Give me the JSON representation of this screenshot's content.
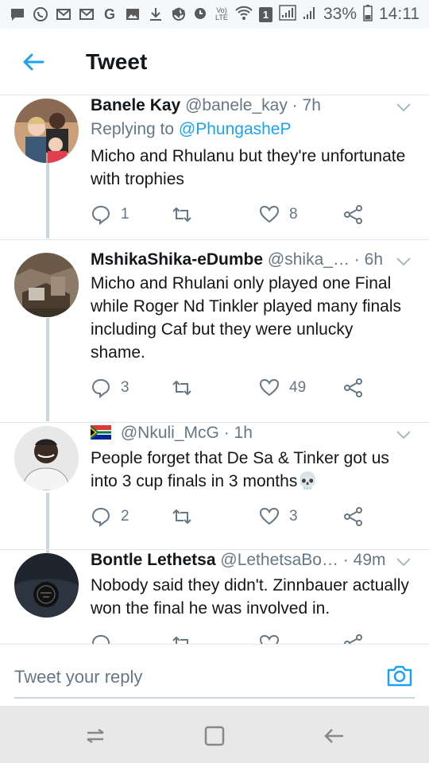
{
  "status_bar": {
    "left_icons": [
      "message-icon",
      "whatsapp-icon",
      "gmail-icon",
      "gmail-icon",
      "google-icon",
      "gallery-icon",
      "download-icon",
      "sync-icon"
    ],
    "right_icons": [
      "mute-icon",
      "alarm-icon",
      "volte-icon",
      "wifi-icon",
      "sim-icon",
      "signal-icon",
      "signal-icon"
    ],
    "sim_label": "1",
    "volte_label": "Vo) LTE",
    "battery": "33%",
    "time": "14:11"
  },
  "header": {
    "title": "Tweet"
  },
  "tweets": [
    {
      "name": "Banele Kay",
      "handle": "@banele_kay",
      "dot": "·",
      "time": "7h",
      "replying_prefix": "Replying to",
      "replying_to": "@PhungasheP",
      "text": "Micho and Rhulanu but they're unfortunate with trophies",
      "replies": "1",
      "retweets": "",
      "likes": "8"
    },
    {
      "name": "MshikaShika-eDumbe",
      "handle": "@shika_…",
      "dot": "·",
      "time": "6h",
      "text": "Micho and Rhulani only played one Final while Roger Nd Tinkler played many finals including Caf but they were unlucky shame.",
      "replies": "3",
      "retweets": "",
      "likes": "49"
    },
    {
      "name": "",
      "handle": "@Nkuli_McG",
      "dot": "·",
      "time": "1h",
      "text": "People forget that De Sa & Tinker got us into 3 cup finals in 3 months💀",
      "replies": "2",
      "retweets": "",
      "likes": "3"
    },
    {
      "name": "Bontle Lethetsa",
      "handle": "@LethetsaBo…",
      "dot": "·",
      "time": "49m",
      "text": "Nobody said they didn't. Zinnbauer actually won the final he was involved in.",
      "replies": "",
      "retweets": "",
      "likes": ""
    }
  ],
  "reply_bar": {
    "placeholder": "Tweet your reply"
  },
  "colors": {
    "accent": "#1da1f2",
    "secondary_text": "#657786",
    "divider": "#e1e8ed"
  }
}
